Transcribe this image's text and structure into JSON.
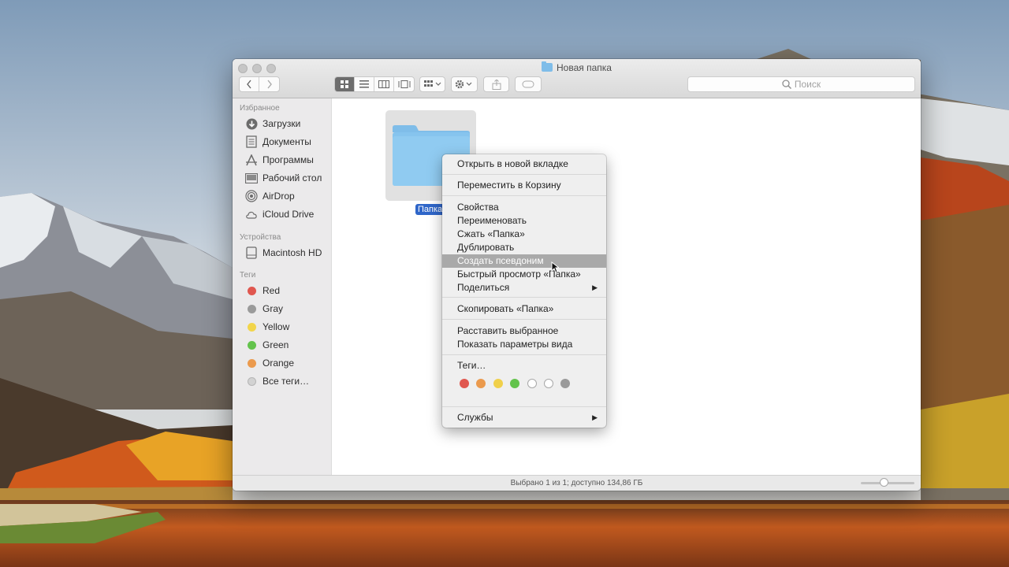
{
  "window": {
    "title": "Новая папка",
    "search_placeholder": "Поиск"
  },
  "sidebar": {
    "favorites_header": "Избранное",
    "favorites": [
      {
        "label": "Загрузки",
        "icon": "downloads-icon"
      },
      {
        "label": "Документы",
        "icon": "documents-icon"
      },
      {
        "label": "Программы",
        "icon": "applications-icon"
      },
      {
        "label": "Рабочий стол",
        "icon": "desktop-icon"
      },
      {
        "label": "AirDrop",
        "icon": "airdrop-icon"
      },
      {
        "label": "iCloud Drive",
        "icon": "cloud-icon"
      }
    ],
    "devices_header": "Устройства",
    "devices": [
      {
        "label": "Macintosh HD",
        "icon": "hard-drive-icon"
      }
    ],
    "tags_header": "Теги",
    "tags": [
      {
        "label": "Red",
        "color": "#e0574f"
      },
      {
        "label": "Gray",
        "color": "#9a9a9a"
      },
      {
        "label": "Yellow",
        "color": "#f2d54b"
      },
      {
        "label": "Green",
        "color": "#63c34c"
      },
      {
        "label": "Orange",
        "color": "#eb9a4d"
      },
      {
        "label": "Все теги…",
        "color": "#d2d2d2"
      }
    ]
  },
  "content": {
    "folder_name": "Папка"
  },
  "status": {
    "text": "Выбрано 1 из 1; доступно 134,86 ГБ"
  },
  "context_menu": {
    "items": [
      "Открыть в новой вкладке",
      "Переместить в Корзину",
      "Свойства",
      "Переименовать",
      "Сжать «Папка»",
      "Дублировать",
      "Создать псевдоним",
      "Быстрый просмотр «Папка»",
      "Поделиться",
      "Скопировать «Папка»",
      "Расставить выбранное",
      "Показать параметры вида",
      "Теги…",
      "Службы"
    ],
    "highlighted": "Создать псевдоним",
    "tag_colors": [
      "#e0574f",
      "#eb9a4d",
      "#f0d04a",
      "#63c34c",
      "#ffffff",
      "#ffffff",
      "#9a9a9a"
    ]
  }
}
